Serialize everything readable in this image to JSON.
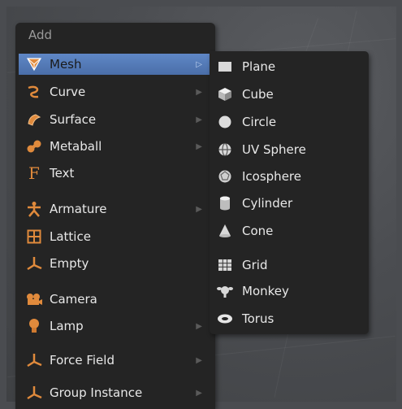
{
  "menu": {
    "title": "Add",
    "items": [
      {
        "label": "Mesh",
        "icon": "mesh-icon",
        "submenu": true,
        "selected": true
      },
      {
        "label": "Curve",
        "icon": "curve-icon",
        "submenu": true
      },
      {
        "label": "Surface",
        "icon": "surface-icon",
        "submenu": true
      },
      {
        "label": "Metaball",
        "icon": "metaball-icon",
        "submenu": true
      },
      {
        "label": "Text",
        "icon": "text-icon",
        "submenu": false
      },
      {
        "label": "Armature",
        "icon": "armature-icon",
        "submenu": true
      },
      {
        "label": "Lattice",
        "icon": "lattice-icon",
        "submenu": false
      },
      {
        "label": "Empty",
        "icon": "empty-icon",
        "submenu": true
      },
      {
        "label": "Camera",
        "icon": "camera-icon",
        "submenu": false
      },
      {
        "label": "Lamp",
        "icon": "lamp-icon",
        "submenu": true
      },
      {
        "label": "Force Field",
        "icon": "force-field-icon",
        "submenu": true
      },
      {
        "label": "Group Instance",
        "icon": "group-instance-icon",
        "submenu": true
      }
    ]
  },
  "submenu": {
    "items": [
      {
        "label": "Plane",
        "icon": "plane-icon"
      },
      {
        "label": "Cube",
        "icon": "cube-icon"
      },
      {
        "label": "Circle",
        "icon": "circle-icon"
      },
      {
        "label": "UV Sphere",
        "icon": "uv-sphere-icon"
      },
      {
        "label": "Icosphere",
        "icon": "icosphere-icon"
      },
      {
        "label": "Cylinder",
        "icon": "cylinder-icon"
      },
      {
        "label": "Cone",
        "icon": "cone-icon"
      },
      {
        "label": "Grid",
        "icon": "grid-icon"
      },
      {
        "label": "Monkey",
        "icon": "monkey-icon"
      },
      {
        "label": "Torus",
        "icon": "torus-icon"
      }
    ]
  },
  "colors": {
    "menu_bg": "#242424",
    "selected": "#5a82c2",
    "text": "#e8e8e8",
    "title": "#9a9a9a",
    "icon_orange": "#e08a3c",
    "icon_light": "#d8d8d8"
  }
}
